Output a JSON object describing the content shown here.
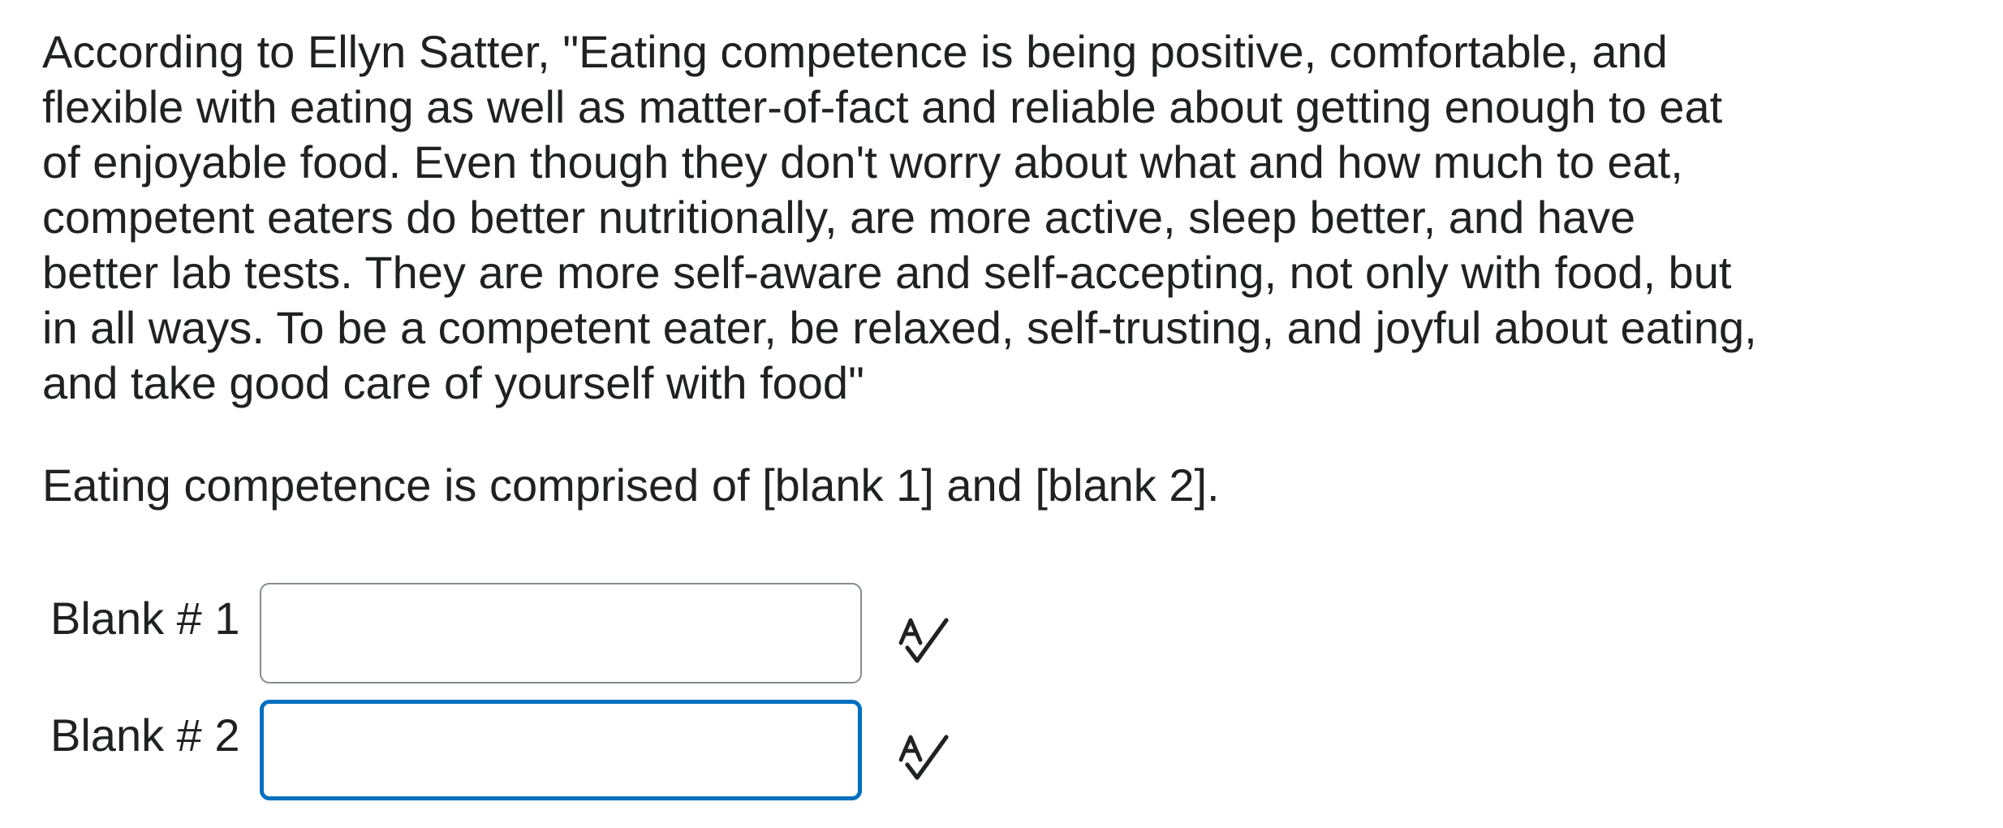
{
  "question": {
    "passage_lines": [
      "According to Ellyn Satter, \"Eating competence is being positive, comfortable, and",
      "flexible with eating as well as matter-of-fact and reliable about getting enough to eat",
      "of enjoyable food. Even though they don't worry about what and how much to eat,",
      "competent eaters do better nutritionally, are more active, sleep better, and have",
      "better lab tests. They are more self-aware and self-accepting, not only with food, but",
      "in all ways. To be a competent eater, be relaxed, self-trusting, and joyful about eating,",
      "and take good care of yourself with food\""
    ],
    "prompt": "Eating competence is comprised of [blank 1] and [blank 2]."
  },
  "blanks": [
    {
      "label": "Blank # 1",
      "value": "",
      "focused": false,
      "icon": "spellcheck-icon"
    },
    {
      "label": "Blank # 2",
      "value": "",
      "focused": true,
      "icon": "spellcheck-icon"
    }
  ],
  "colors": {
    "text": "#202122",
    "input_border": "#868c8f",
    "focus_border": "#006fbf"
  }
}
